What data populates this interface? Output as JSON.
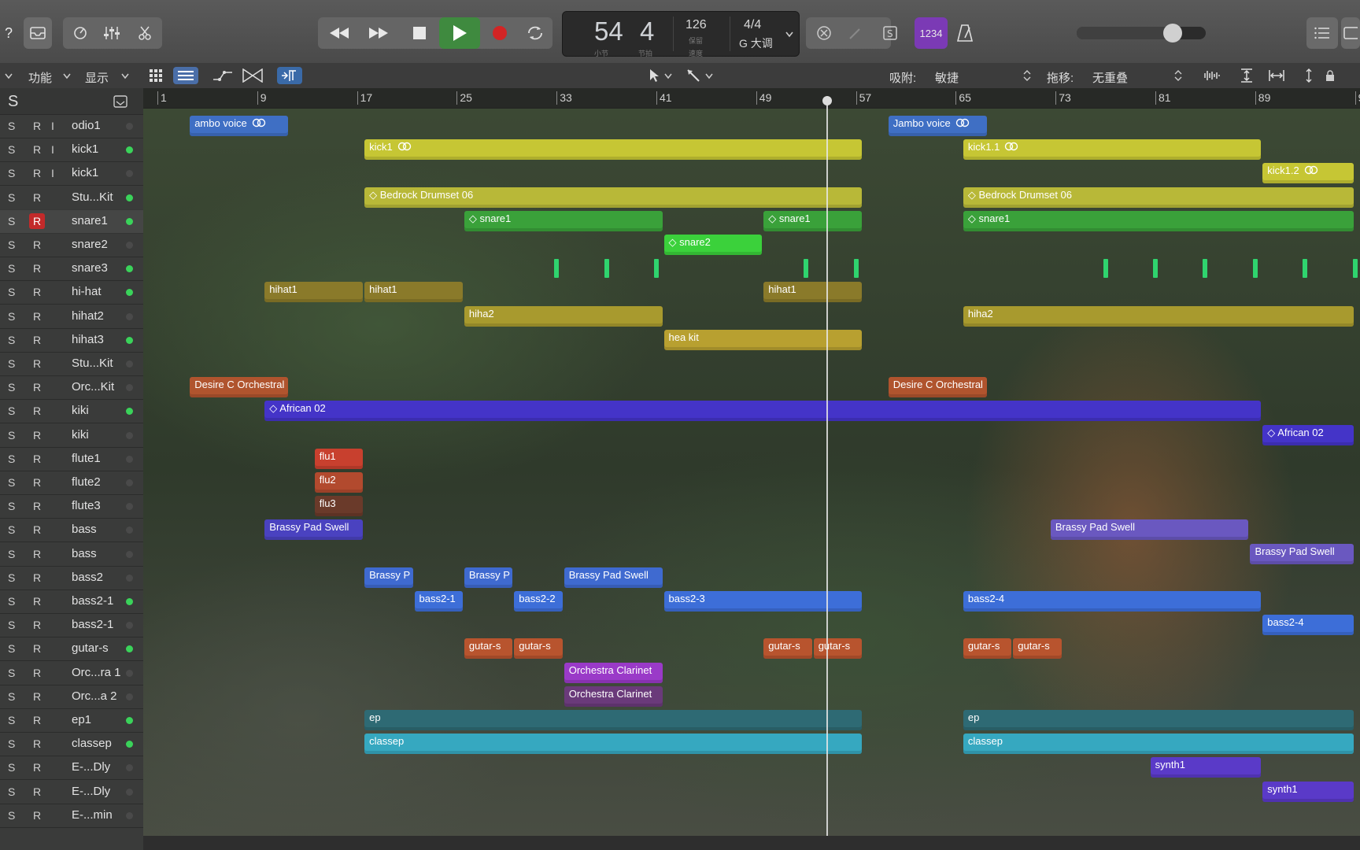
{
  "transport": {
    "lcd": {
      "bar": "54",
      "beat": "4",
      "bar_label": "小节",
      "beat_label": "节拍",
      "tempo": "126",
      "tempo_label": "保留",
      "time_sig": "4/4",
      "key": "G 大调",
      "key_label": "速度"
    },
    "count_in_label": "1234"
  },
  "toolbar2": {
    "func_label": "功能",
    "view_label": "显示",
    "snap_label": "吸附:",
    "snap_value": "敏捷",
    "drag_label": "拖移:",
    "drag_value": "无重叠"
  },
  "trackpanel": {
    "header_s": "S"
  },
  "tracks": [
    {
      "name": "odio1",
      "r_active": false,
      "input": true,
      "on": false
    },
    {
      "name": "kick1",
      "r_active": false,
      "input": true,
      "on": true
    },
    {
      "name": "kick1",
      "r_active": false,
      "input": true,
      "on": false
    },
    {
      "name": "Stu...Kit",
      "r_active": false,
      "input": false,
      "on": true
    },
    {
      "name": "snare1",
      "r_active": true,
      "input": false,
      "on": true
    },
    {
      "name": "snare2",
      "r_active": false,
      "input": false,
      "on": false
    },
    {
      "name": "snare3",
      "r_active": false,
      "input": false,
      "on": true
    },
    {
      "name": "hi-hat",
      "r_active": false,
      "input": false,
      "on": true
    },
    {
      "name": "hihat2",
      "r_active": false,
      "input": false,
      "on": false
    },
    {
      "name": "hihat3",
      "r_active": false,
      "input": false,
      "on": true
    },
    {
      "name": "Stu...Kit",
      "r_active": false,
      "input": false,
      "on": false
    },
    {
      "name": "Orc...Kit",
      "r_active": false,
      "input": false,
      "on": false
    },
    {
      "name": "kiki",
      "r_active": false,
      "input": false,
      "on": true
    },
    {
      "name": "kiki",
      "r_active": false,
      "input": false,
      "on": false
    },
    {
      "name": "flute1",
      "r_active": false,
      "input": false,
      "on": false
    },
    {
      "name": "flute2",
      "r_active": false,
      "input": false,
      "on": false
    },
    {
      "name": "flute3",
      "r_active": false,
      "input": false,
      "on": false
    },
    {
      "name": "bass",
      "r_active": false,
      "input": false,
      "on": false
    },
    {
      "name": "bass",
      "r_active": false,
      "input": false,
      "on": false
    },
    {
      "name": "bass2",
      "r_active": false,
      "input": false,
      "on": false
    },
    {
      "name": "bass2-1",
      "r_active": false,
      "input": false,
      "on": true
    },
    {
      "name": "bass2-1",
      "r_active": false,
      "input": false,
      "on": false
    },
    {
      "name": "gutar-s",
      "r_active": false,
      "input": false,
      "on": true
    },
    {
      "name": "Orc...ra 1",
      "r_active": false,
      "input": false,
      "on": false
    },
    {
      "name": "Orc...a 2",
      "r_active": false,
      "input": false,
      "on": false
    },
    {
      "name": "ep1",
      "r_active": false,
      "input": false,
      "on": true
    },
    {
      "name": "classep",
      "r_active": false,
      "input": false,
      "on": true
    },
    {
      "name": "E-...Dly",
      "r_active": false,
      "input": false,
      "on": false
    },
    {
      "name": "E-...Dly",
      "r_active": false,
      "input": false,
      "on": false
    },
    {
      "name": "E-...min",
      "r_active": false,
      "input": false,
      "on": false
    }
  ],
  "ruler": [
    "1",
    "9",
    "17",
    "25",
    "33",
    "41",
    "49",
    "57",
    "65",
    "73",
    "81",
    "89",
    "9"
  ],
  "playhead_bar": 54,
  "regions": [
    {
      "row": 0,
      "start": 3.6,
      "end": 11.6,
      "label": "ambo voice",
      "color": "#3f6fc4",
      "loop": true
    },
    {
      "row": 0,
      "start": 59.6,
      "end": 67.6,
      "label": "Jambo voice",
      "color": "#3f6fc4",
      "loop": true
    },
    {
      "row": 1,
      "start": 17.6,
      "end": 57.6,
      "label": "kick1",
      "color": "#c6c634",
      "loop": true
    },
    {
      "row": 1,
      "start": 65.6,
      "end": 89.6,
      "label": "kick1.1",
      "color": "#c6c634",
      "loop": true
    },
    {
      "row": 2,
      "start": 89.6,
      "end": 97,
      "label": "kick1.2",
      "color": "#c6c634",
      "loop": true
    },
    {
      "row": 3,
      "start": 17.6,
      "end": 57.6,
      "label": "◇ Bedrock Drumset 06",
      "color": "#b8b838",
      "loop": false
    },
    {
      "row": 3,
      "start": 65.6,
      "end": 97,
      "label": "◇ Bedrock Drumset 06",
      "color": "#b8b838",
      "loop": false
    },
    {
      "row": 4,
      "start": 25.6,
      "end": 41.6,
      "label": "◇ snare1",
      "color": "#3aa13a",
      "loop": false
    },
    {
      "row": 4,
      "start": 49.6,
      "end": 57.6,
      "label": "◇ snare1",
      "color": "#3aa13a",
      "loop": false
    },
    {
      "row": 4,
      "start": 65.6,
      "end": 97,
      "label": "◇ snare1",
      "color": "#3aa13a",
      "loop": false
    },
    {
      "row": 5,
      "start": 41.6,
      "end": 49.6,
      "label": "◇ snare2",
      "color": "#3bd13b",
      "loop": false
    },
    {
      "row": 7,
      "start": 9.6,
      "end": 17.6,
      "label": "hihat1",
      "color": "#8a7a2a",
      "loop": false
    },
    {
      "row": 7,
      "start": 17.6,
      "end": 25.6,
      "label": "hihat1",
      "color": "#8a7a2a",
      "loop": false
    },
    {
      "row": 7,
      "start": 49.6,
      "end": 57.6,
      "label": "hihat1",
      "color": "#8a7a2a",
      "loop": false
    },
    {
      "row": 8,
      "start": 25.6,
      "end": 41.6,
      "label": "hiha2",
      "color": "#a89a2e",
      "loop": false
    },
    {
      "row": 8,
      "start": 65.6,
      "end": 97,
      "label": "hiha2",
      "color": "#a89a2e",
      "loop": false
    },
    {
      "row": 9,
      "start": 41.6,
      "end": 57.6,
      "label": "hea kit",
      "color": "#b8a030",
      "loop": false
    },
    {
      "row": 11,
      "start": 3.6,
      "end": 11.6,
      "label": "Desire C Orchestral",
      "color": "#b0542e",
      "loop": false
    },
    {
      "row": 11,
      "start": 59.6,
      "end": 67.6,
      "label": "Desire C Orchestral",
      "color": "#b0542e",
      "loop": false
    },
    {
      "row": 12,
      "start": 9.6,
      "end": 89.6,
      "label": "◇ African 02",
      "color": "#4434c8",
      "loop": false
    },
    {
      "row": 13,
      "start": 89.6,
      "end": 97,
      "label": "◇ African 02",
      "color": "#4434c8",
      "loop": false
    },
    {
      "row": 14,
      "start": 13.6,
      "end": 17.6,
      "label": "flu1",
      "color": "#c8402e",
      "loop": false
    },
    {
      "row": 15,
      "start": 13.6,
      "end": 17.6,
      "label": "flu2",
      "color": "#b24a2e",
      "loop": false
    },
    {
      "row": 16,
      "start": 13.6,
      "end": 17.6,
      "label": "flu3",
      "color": "#6a3a2a",
      "loop": false
    },
    {
      "row": 17,
      "start": 9.6,
      "end": 17.6,
      "label": "Brassy Pad Swell",
      "color": "#4a42c0",
      "loop": false
    },
    {
      "row": 17,
      "start": 72.6,
      "end": 88.6,
      "label": "Brassy Pad Swell",
      "color": "#6a58c0",
      "loop": false
    },
    {
      "row": 18,
      "start": 88.6,
      "end": 97,
      "label": "Brassy Pad Swell",
      "color": "#6a58c0",
      "loop": false
    },
    {
      "row": 19,
      "start": 17.6,
      "end": 21.6,
      "label": "Brassy P",
      "color": "#3f6ad0",
      "loop": false
    },
    {
      "row": 19,
      "start": 25.6,
      "end": 29.6,
      "label": "Brassy P",
      "color": "#3f6ad0",
      "loop": false
    },
    {
      "row": 19,
      "start": 33.6,
      "end": 41.6,
      "label": "Brassy Pad Swell",
      "color": "#3f6ad0",
      "loop": false
    },
    {
      "row": 20,
      "start": 21.6,
      "end": 25.6,
      "label": "bass2-1",
      "color": "#3d6ed8",
      "loop": false
    },
    {
      "row": 20,
      "start": 29.6,
      "end": 33.6,
      "label": "bass2-2",
      "color": "#3d6ed8",
      "loop": false
    },
    {
      "row": 20,
      "start": 41.6,
      "end": 57.6,
      "label": "bass2-3",
      "color": "#3d6ed8",
      "loop": false
    },
    {
      "row": 20,
      "start": 65.6,
      "end": 89.6,
      "label": "bass2-4",
      "color": "#3d6ed8",
      "loop": false
    },
    {
      "row": 21,
      "start": 89.6,
      "end": 97,
      "label": "bass2-4",
      "color": "#3d6ed8",
      "loop": false
    },
    {
      "row": 22,
      "start": 25.6,
      "end": 29.6,
      "label": "gutar-s",
      "color": "#b8542e",
      "loop": false
    },
    {
      "row": 22,
      "start": 29.6,
      "end": 33.6,
      "label": "gutar-s",
      "color": "#b8542e",
      "loop": false
    },
    {
      "row": 22,
      "start": 49.6,
      "end": 53.6,
      "label": "gutar-s",
      "color": "#b8542e",
      "loop": false
    },
    {
      "row": 22,
      "start": 53.6,
      "end": 57.6,
      "label": "gutar-s",
      "color": "#b8542e",
      "loop": false
    },
    {
      "row": 22,
      "start": 65.6,
      "end": 69.6,
      "label": "gutar-s",
      "color": "#b8542e",
      "loop": false
    },
    {
      "row": 22,
      "start": 69.6,
      "end": 73.6,
      "label": "gutar-s",
      "color": "#b8542e",
      "loop": false
    },
    {
      "row": 23,
      "start": 33.6,
      "end": 41.6,
      "label": "Orchestra Clarinet",
      "color": "#9a3ac8",
      "loop": false
    },
    {
      "row": 24,
      "start": 33.6,
      "end": 41.6,
      "label": "Orchestra Clarinet",
      "color": "#6a3a7a",
      "loop": false
    },
    {
      "row": 25,
      "start": 17.6,
      "end": 57.6,
      "label": "ep",
      "color": "#2e6a74",
      "loop": false
    },
    {
      "row": 25,
      "start": 65.6,
      "end": 97,
      "label": "ep",
      "color": "#2e6a74",
      "loop": false
    },
    {
      "row": 26,
      "start": 17.6,
      "end": 57.6,
      "label": "classep",
      "color": "#36a8c0",
      "loop": false
    },
    {
      "row": 26,
      "start": 65.6,
      "end": 97,
      "label": "classep",
      "color": "#36a8c0",
      "loop": false
    },
    {
      "row": 27,
      "start": 80.6,
      "end": 89.6,
      "label": "synth1",
      "color": "#5a3ac8",
      "loop": false
    },
    {
      "row": 28,
      "start": 89.6,
      "end": 97,
      "label": "synth1",
      "color": "#5a3ac8",
      "loop": false
    }
  ],
  "snare3_markers": [
    33,
    37,
    41,
    53,
    57,
    77,
    81,
    85,
    89,
    93,
    97
  ]
}
